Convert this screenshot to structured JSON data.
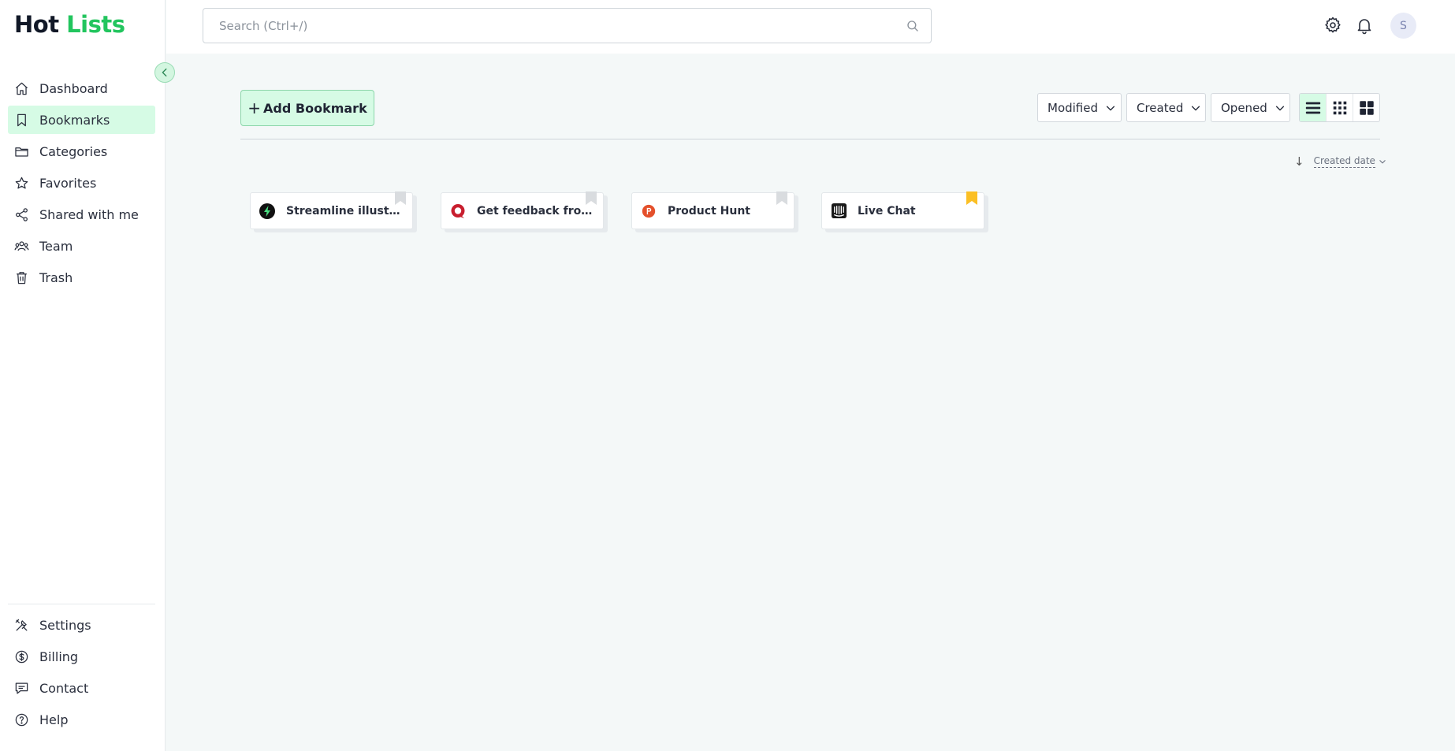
{
  "brand": {
    "part1": "Hot",
    "part2": "Lists"
  },
  "sidebar": {
    "items": [
      {
        "label": "Dashboard",
        "icon": "home-icon",
        "active": false
      },
      {
        "label": "Bookmarks",
        "icon": "bookmark-icon",
        "active": true
      },
      {
        "label": "Categories",
        "icon": "folder-icon",
        "active": false
      },
      {
        "label": "Favorites",
        "icon": "star-icon",
        "active": false
      },
      {
        "label": "Shared with me",
        "icon": "share-icon",
        "active": false
      },
      {
        "label": "Team",
        "icon": "team-icon",
        "active": false
      },
      {
        "label": "Trash",
        "icon": "trash-icon",
        "active": false
      }
    ],
    "bottom_items": [
      {
        "label": "Settings",
        "icon": "tools-icon"
      },
      {
        "label": "Billing",
        "icon": "dollar-icon"
      },
      {
        "label": "Contact",
        "icon": "chat-icon"
      },
      {
        "label": "Help",
        "icon": "help-icon"
      }
    ]
  },
  "search": {
    "placeholder": "Search (Ctrl+/)"
  },
  "user": {
    "initial": "S"
  },
  "toolbar": {
    "add_label": "Add Bookmark",
    "filters": [
      "Modified",
      "Created",
      "Opened"
    ],
    "active_view": "list"
  },
  "sort": {
    "label": "Created date"
  },
  "bookmarks": [
    {
      "title": "Streamline illustrati...",
      "favicon": "bolt-circle-icon",
      "favorite": false
    },
    {
      "title": "Get feedback from ...",
      "favicon": "red-chat-icon",
      "favorite": false
    },
    {
      "title": "Product Hunt",
      "favicon": "product-hunt-icon",
      "favorite": false
    },
    {
      "title": "Live Chat",
      "favicon": "intercom-icon",
      "favorite": true
    }
  ],
  "colors": {
    "accent": "#22c55e",
    "active_bg": "#d6fbe5",
    "favorite": "#fbbf24",
    "not_favorite": "#d9dcdf"
  }
}
